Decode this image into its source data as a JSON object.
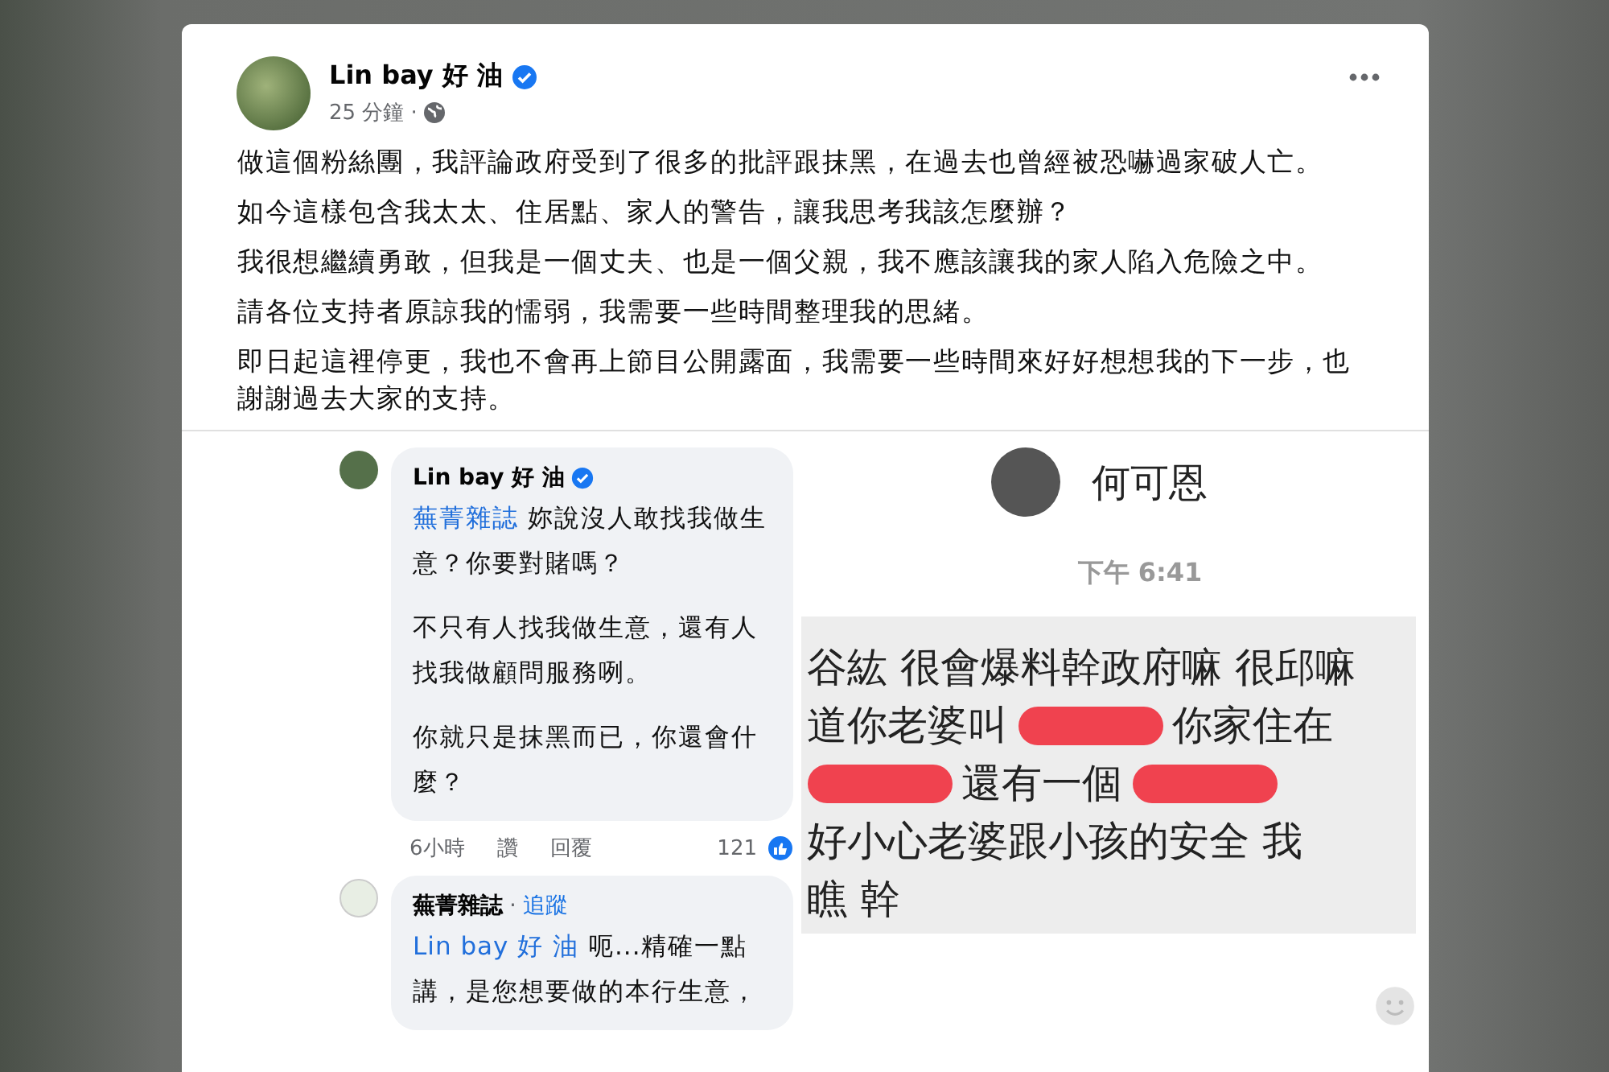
{
  "post": {
    "author": "Lin bay 好 油",
    "verified": true,
    "time": "25 分鐘 ·",
    "paragraphs": [
      "做這個粉絲團，我評論政府受到了很多的批評跟抹黑，在過去也曾經被恐嚇過家破人亡。",
      "如今這樣包含我太太、住居點、家人的警告，讓我思考我該怎麼辦？",
      "我很想繼續勇敢，但我是一個丈夫、也是一個父親，我不應該讓我的家人陷入危險之中。",
      "請各位支持者原諒我的懦弱，我需要一些時間整理我的思緒。",
      "即日起這裡停更，我也不會再上節目公開露面，我需要一些時間來好好想想我的下一步，也謝謝過去大家的支持。"
    ]
  },
  "comments": [
    {
      "author": "Lin bay 好 油",
      "verified": true,
      "mention": "蕪菁雜誌",
      "paragraphs": [
        "妳說沒人敢找我做生意？你要對賭嗎？",
        "不只有人找我做生意，還有人找我做顧問服務咧。",
        "你就只是抹黑而已，你還會什麼？"
      ],
      "meta": {
        "time": "6小時",
        "actions": [
          "讚",
          "回覆"
        ],
        "likes": "121"
      }
    },
    {
      "author": "蕪菁雜誌",
      "verified": false,
      "follow_prefix": "·",
      "follow": "追蹤",
      "mention": "Lin bay 好 油",
      "paragraphs": [
        "呃...精確一點講，是您想要做的本行生意，"
      ]
    }
  ],
  "message": {
    "contact": "何可恩",
    "time": "下午 6:41",
    "lines": [
      [
        {
          "kind": "text",
          "text": "谷紘 很會爆料幹政府嘛 很邱嘛"
        }
      ],
      [
        {
          "kind": "text",
          "text": "道你老婆叫"
        },
        {
          "kind": "redaction"
        },
        {
          "kind": "text",
          "text": "你家住在"
        }
      ],
      [
        {
          "kind": "redaction"
        },
        {
          "kind": "text",
          "text": "還有一個"
        },
        {
          "kind": "redaction"
        }
      ],
      [
        {
          "kind": "text",
          "text": "好小心老婆跟小孩的安全 我"
        }
      ],
      [
        {
          "kind": "text",
          "text": "瞧 幹"
        }
      ]
    ]
  }
}
